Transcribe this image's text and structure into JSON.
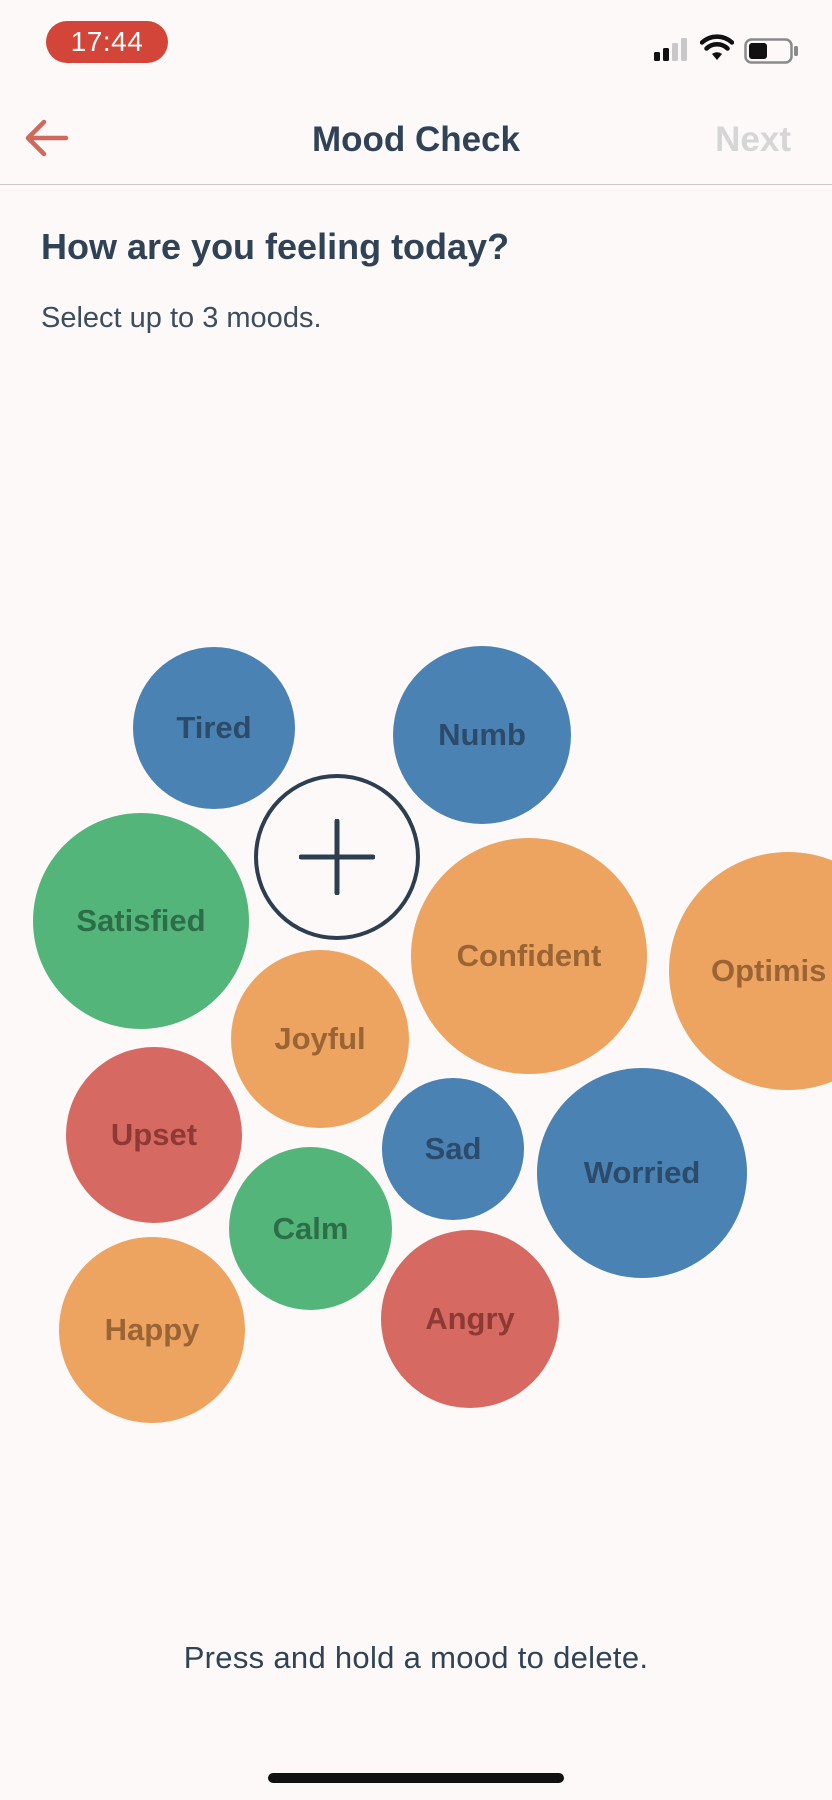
{
  "status_bar": {
    "time": "17:44",
    "time_pill_color": "#d24538",
    "icons": [
      "cellular-signal-icon",
      "wifi-icon",
      "battery-icon"
    ]
  },
  "nav": {
    "back_icon": "arrow-left-icon",
    "back_color": "#d0685d",
    "title": "Mood Check",
    "next_label": "Next"
  },
  "prompt": {
    "question": "How are you feeling today?",
    "instruction": "Select up to 3 moods."
  },
  "add_button": {
    "icon": "plus-icon"
  },
  "moods": [
    {
      "label": "Tired",
      "color": "blue"
    },
    {
      "label": "Numb",
      "color": "blue"
    },
    {
      "label": "Satisfied",
      "color": "green"
    },
    {
      "label": "Confident",
      "color": "orange"
    },
    {
      "label": "Optimis",
      "color": "orange"
    },
    {
      "label": "Joyful",
      "color": "orange"
    },
    {
      "label": "Upset",
      "color": "red"
    },
    {
      "label": "Sad",
      "color": "blue"
    },
    {
      "label": "Worried",
      "color": "blue"
    },
    {
      "label": "Calm",
      "color": "green"
    },
    {
      "label": "Happy",
      "color": "orange"
    },
    {
      "label": "Angry",
      "color": "red"
    }
  ],
  "palette": {
    "blue": "#4a82b3",
    "green": "#54b57b",
    "orange": "#eda461",
    "red": "#d66961"
  },
  "footer": {
    "hint": "Press and hold a mood to delete."
  }
}
